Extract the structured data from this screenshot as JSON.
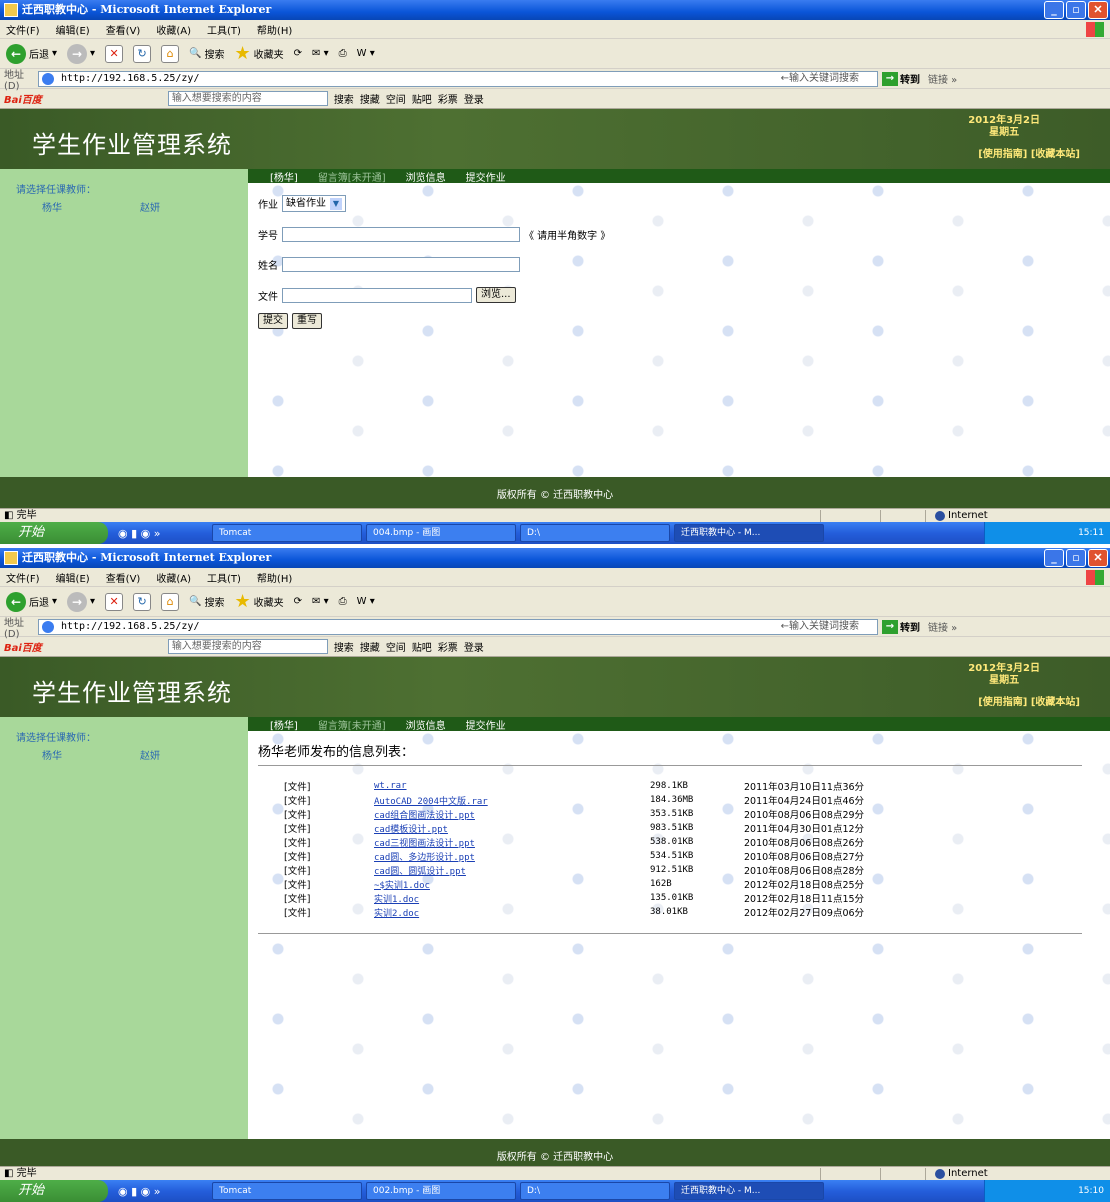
{
  "window": {
    "title": "迁西职教中心 - Microsoft Internet Explorer",
    "menu": [
      "文件(F)",
      "编辑(E)",
      "查看(V)",
      "收藏(A)",
      "工具(T)",
      "帮助(H)"
    ],
    "toolbar": {
      "back": "后退",
      "search": "搜索",
      "favorites": "收藏夹"
    },
    "address_label": "地址(D)",
    "url": "http://192.168.5.25/zy/",
    "address_hint": "←输入关键词搜索",
    "go": "转到",
    "links": "链接 »"
  },
  "baidu": {
    "logo": "Bai百度",
    "placeholder": "输入想要搜索的内容",
    "items": [
      "搜索",
      "搜藏",
      "空间",
      "贴吧",
      "彩票",
      "登录"
    ]
  },
  "site": {
    "title": "学生作业管理系统",
    "date_line1": "2012年3月2日",
    "date_line2": "星期五",
    "links": "[使用指南] [收藏本站]",
    "sidebar_title": "请选择任课教师：",
    "teachers": [
      "杨华",
      "赵妍"
    ],
    "nav": {
      "current": "[杨华]",
      "guestbook": "留言簿[未开通]",
      "browse": "浏览信息",
      "submit": "提交作业"
    },
    "footer": "版权所有 © 迁西职教中心"
  },
  "form": {
    "assignment_label": "作业",
    "assignment_value": "缺省作业",
    "id_label": "学号",
    "id_hint": "《 请用半角数字 》",
    "name_label": "姓名",
    "file_label": "文件",
    "browse": "浏览...",
    "submit": "提交",
    "reset": "重写"
  },
  "list": {
    "title": "杨华老师发布的信息列表：",
    "rows": [
      {
        "kind": "[文件]",
        "name": "wt.rar",
        "size": "298.1KB",
        "date": "2011年03月10日11点36分"
      },
      {
        "kind": "[文件]",
        "name": "AutoCAD 2004中文版.rar",
        "size": "184.36MB",
        "date": "2011年04月24日01点46分"
      },
      {
        "kind": "[文件]",
        "name": "cad组合图画法设计.ppt",
        "size": "353.51KB",
        "date": "2010年08月06日08点29分"
      },
      {
        "kind": "[文件]",
        "name": "cad模板设计.ppt",
        "size": "983.51KB",
        "date": "2011年04月30日01点12分"
      },
      {
        "kind": "[文件]",
        "name": "cad三视图画法设计.ppt",
        "size": "538.01KB",
        "date": "2010年08月06日08点26分"
      },
      {
        "kind": "[文件]",
        "name": "cad圆、多边形设计.ppt",
        "size": "534.51KB",
        "date": "2010年08月06日08点27分"
      },
      {
        "kind": "[文件]",
        "name": "cad圆、圆弧设计.ppt",
        "size": "912.51KB",
        "date": "2010年08月06日08点28分"
      },
      {
        "kind": "[文件]",
        "name": "~$实训1.doc",
        "size": "162B",
        "date": "2012年02月18日08点25分"
      },
      {
        "kind": "[文件]",
        "name": "实训1.doc",
        "size": "135.01KB",
        "date": "2012年02月18日11点15分"
      },
      {
        "kind": "[文件]",
        "name": "实训2.doc",
        "size": "38.01KB",
        "date": "2012年02月27日09点06分"
      }
    ]
  },
  "status": {
    "text": "完毕",
    "zone": "Internet"
  },
  "taskbar": {
    "start": "开始",
    "tasks_top": [
      "Tomcat",
      "004.bmp - 画图",
      "D:\\",
      "迁西职教中心 - M..."
    ],
    "tasks_bottom": [
      "Tomcat",
      "002.bmp - 画图",
      "D:\\",
      "迁西职教中心 - M..."
    ],
    "time_top": "15:11",
    "time_bottom": "15:10"
  },
  "colors": {
    "banner": "#3a5a26",
    "sidebar": "#a8d89a",
    "nav": "#1f5a17",
    "link": "#1a3fb5"
  }
}
